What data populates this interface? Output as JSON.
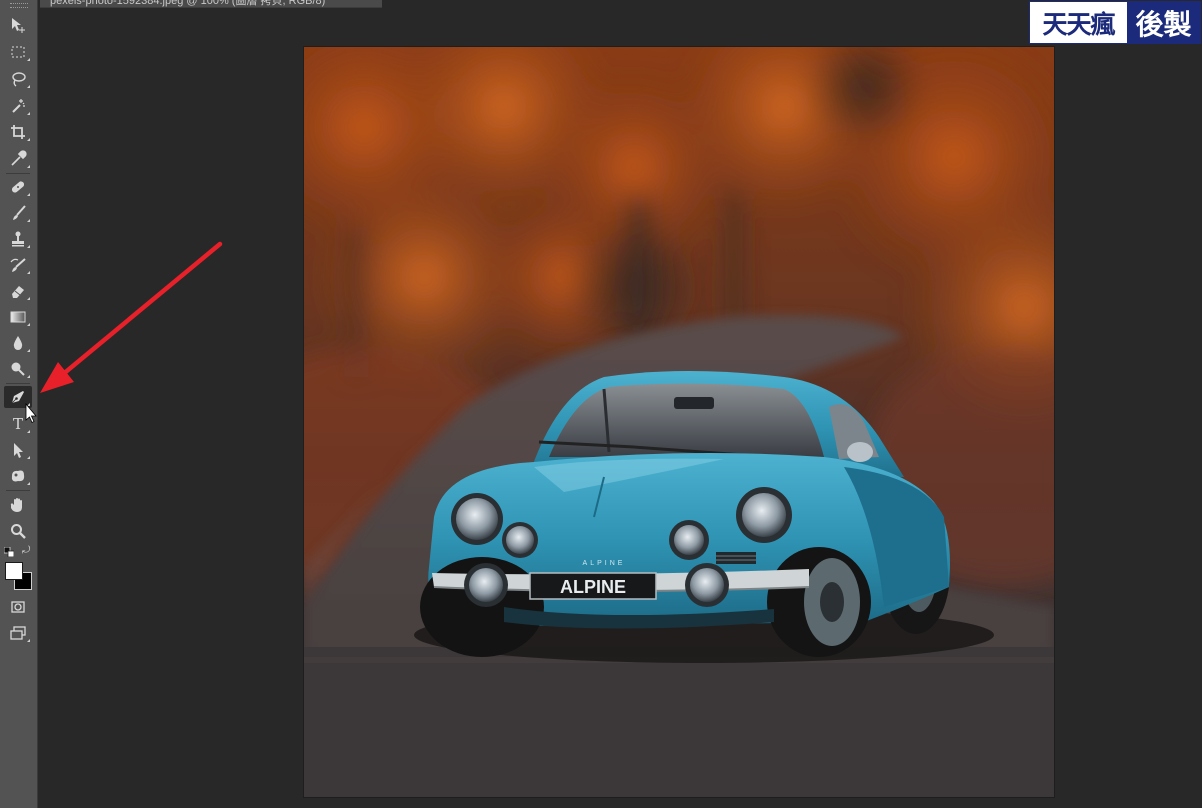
{
  "document": {
    "tab_title": "pexels-photo-1592384.jpeg @ 100% (圖層 拷貝, RGB/8)"
  },
  "toolbox": {
    "tools": [
      {
        "name": "move-tool",
        "icon": "move-icon"
      },
      {
        "name": "marquee-tool",
        "icon": "rect-marquee-icon"
      },
      {
        "name": "lasso-tool",
        "icon": "lasso-icon"
      },
      {
        "name": "magic-wand-tool",
        "icon": "magic-wand-icon"
      },
      {
        "name": "crop-tool",
        "icon": "crop-icon"
      },
      {
        "name": "eyedropper-tool",
        "icon": "eyedropper-icon"
      },
      {
        "name": "healing-brush-tool",
        "icon": "bandage-icon"
      },
      {
        "name": "brush-tool",
        "icon": "brush-icon"
      },
      {
        "name": "clone-stamp-tool",
        "icon": "stamp-icon"
      },
      {
        "name": "history-brush-tool",
        "icon": "history-brush-icon"
      },
      {
        "name": "eraser-tool",
        "icon": "eraser-icon"
      },
      {
        "name": "gradient-tool",
        "icon": "gradient-icon"
      },
      {
        "name": "blur-tool",
        "icon": "drop-icon"
      },
      {
        "name": "dodge-tool",
        "icon": "dodge-icon"
      },
      {
        "name": "pen-tool",
        "icon": "pen-icon",
        "active": true
      },
      {
        "name": "type-tool",
        "icon": "type-icon",
        "label": "T"
      },
      {
        "name": "path-selection-tool",
        "icon": "arrow-select-icon"
      },
      {
        "name": "custom-shape-tool",
        "icon": "shape-icon"
      },
      {
        "name": "hand-tool",
        "icon": "hand-icon"
      },
      {
        "name": "zoom-tool",
        "icon": "zoom-icon"
      }
    ],
    "foreground_color": "#ffffff",
    "background_color": "#000000"
  },
  "watermark": {
    "left_text": "天天瘋",
    "right_text": "後製",
    "brand_color": "#1b2a7a"
  },
  "photo": {
    "plate_text": "ALPINE",
    "badge_text": "ALPINE",
    "car_color": "#2f93b3"
  },
  "annotation": {
    "arrow_color": "#e8202a"
  }
}
